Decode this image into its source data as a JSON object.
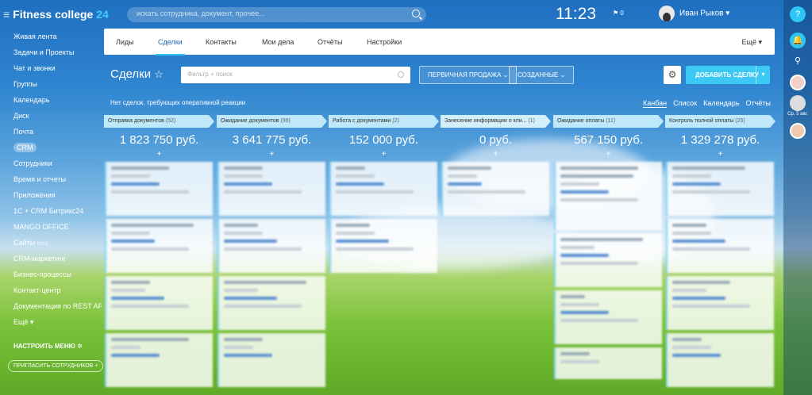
{
  "app": {
    "title_main": "Fitness college",
    "title_num": "24"
  },
  "search": {
    "placeholder": "искать сотрудника, документ, прочее..."
  },
  "clock": "11:23",
  "flag_count": "0",
  "user": {
    "name": "Иван Рыков"
  },
  "left_menu": [
    {
      "label": "Живая лента"
    },
    {
      "label": "Задачи и Проекты"
    },
    {
      "label": "Чат и звонки"
    },
    {
      "label": "Группы"
    },
    {
      "label": "Календарь"
    },
    {
      "label": "Диск"
    },
    {
      "label": "Почта"
    },
    {
      "label": "CRM",
      "active": true
    },
    {
      "label": "Сотрудники"
    },
    {
      "label": "Время и отчеты"
    },
    {
      "label": "Приложения"
    },
    {
      "label": "1С + CRM Битрикс24"
    },
    {
      "label": "MANGO OFFICE"
    },
    {
      "label": "Сайты",
      "sup": "beta"
    },
    {
      "label": "CRM-маркетинг"
    },
    {
      "label": "Бизнес-процессы"
    },
    {
      "label": "Контакт-центр"
    },
    {
      "label": "Документация по REST API"
    },
    {
      "label": "Ещё"
    }
  ],
  "settings_menu": "НАСТРОИТЬ МЕНЮ",
  "invite": "ПРИГЛАСИТЬ СОТРУДНИКОВ",
  "tabs": [
    {
      "label": "Лиды"
    },
    {
      "label": "Сделки",
      "active": true
    },
    {
      "label": "Контакты"
    },
    {
      "label": "Мои дела"
    },
    {
      "label": "Отчёты"
    },
    {
      "label": "Настройки"
    }
  ],
  "tabs_more": "Ещё",
  "page_title": "Сделки",
  "filter": {
    "placeholder": "Фильтр + поиск"
  },
  "dropdowns": {
    "primary_sale": "ПЕРВИЧНАЯ ПРОДАЖА",
    "created": "СОЗДАННЫЕ"
  },
  "add_button": "ДОБАВИТЬ СДЕЛКУ",
  "notice": "Нет сделок, требующих оперативной реакции",
  "views": {
    "kanban": "Канбан",
    "list": "Список",
    "calendar": "Календарь",
    "reports": "Отчёты"
  },
  "right_panel": {
    "date_label": "Ср, 5 авг."
  },
  "columns": [
    {
      "title": "Отправка документов",
      "count": "(52)",
      "sum": "1 823 750 руб.",
      "color": "#bfe9fb"
    },
    {
      "title": "Ожидание документов",
      "count": "(99)",
      "sum": "3 641 775 руб.",
      "color": "#bfe9fb"
    },
    {
      "title": "Работа с документами",
      "count": "(2)",
      "sum": "152 000 руб.",
      "color": "#bfe9fb"
    },
    {
      "title": "Занесение информации о кли...",
      "count": "(1)",
      "sum": "0 руб.",
      "color": "#d2effa"
    },
    {
      "title": "Ожидание оплаты",
      "count": "(11)",
      "sum": "567 150 руб.",
      "color": "#bfe9fb"
    },
    {
      "title": "Контроль полной оплаты",
      "count": "(25)",
      "sum": "1 329 278 руб.",
      "color": "#bfe9fb"
    }
  ],
  "colors": {
    "accent": "#3bc8f5",
    "tab_active": "#2067b0",
    "column_header": "#bfe9fb"
  }
}
